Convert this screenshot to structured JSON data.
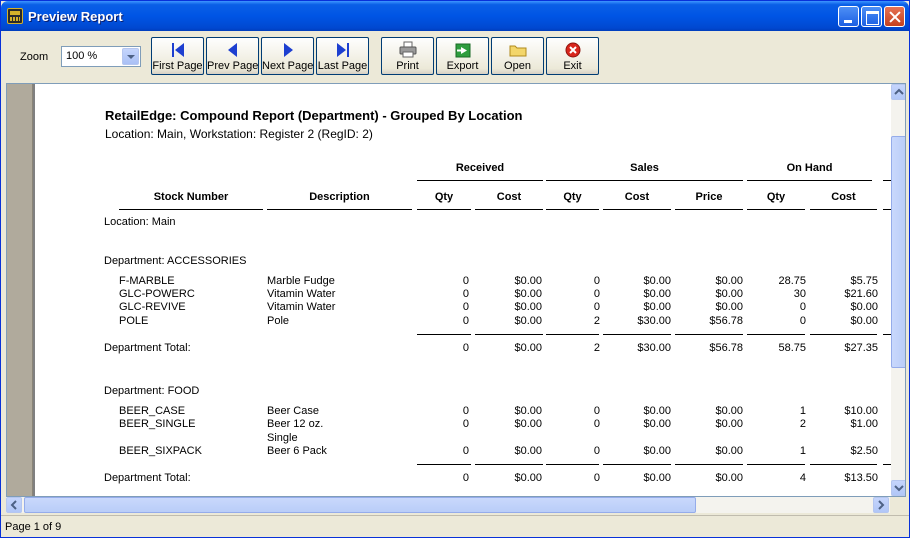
{
  "window": {
    "title": "Preview Report"
  },
  "toolbar": {
    "zoom_label": "Zoom",
    "zoom_value": "100 %",
    "buttons": [
      {
        "label": "First Page",
        "icon": "first-page-icon"
      },
      {
        "label": "Prev Page",
        "icon": "prev-page-icon"
      },
      {
        "label": "Next Page",
        "icon": "next-page-icon"
      },
      {
        "label": "Last Page",
        "icon": "last-page-icon"
      },
      {
        "label": "Print",
        "icon": "printer-icon"
      },
      {
        "label": "Export",
        "icon": "export-icon"
      },
      {
        "label": "Open",
        "icon": "folder-icon"
      },
      {
        "label": "Exit",
        "icon": "exit-icon"
      }
    ]
  },
  "report": {
    "title": "RetailEdge: Compound Report (Department) - Grouped By Location",
    "subtitle": "Location: Main, Workstation: Register 2 (RegID: 2)",
    "group_headers": {
      "received": "Received",
      "sales": "Sales",
      "on_hand": "On Hand"
    },
    "columns": [
      "Stock Number",
      "Description",
      "Qty",
      "Cost",
      "Qty",
      "Cost",
      "Price",
      "Qty",
      "Cost"
    ],
    "location_label": "Location: Main",
    "departments": [
      {
        "label": "Department: ACCESSORIES",
        "rows": [
          {
            "stock": "F-MARBLE",
            "desc": "Marble Fudge",
            "rq": "0",
            "rc": "$0.00",
            "sq": "0",
            "sc": "$0.00",
            "sp": "$0.00",
            "oq": "28.75",
            "oc": "$5.75"
          },
          {
            "stock": "GLC-POWERC",
            "desc": "Vitamin Water",
            "rq": "0",
            "rc": "$0.00",
            "sq": "0",
            "sc": "$0.00",
            "sp": "$0.00",
            "oq": "30",
            "oc": "$21.60"
          },
          {
            "stock": "GLC-REVIVE",
            "desc": "Vitamin Water",
            "rq": "0",
            "rc": "$0.00",
            "sq": "0",
            "sc": "$0.00",
            "sp": "$0.00",
            "oq": "0",
            "oc": "$0.00"
          },
          {
            "stock": "POLE",
            "desc": "Pole",
            "rq": "0",
            "rc": "$0.00",
            "sq": "2",
            "sc": "$30.00",
            "sp": "$56.78",
            "oq": "0",
            "oc": "$0.00"
          }
        ],
        "total": {
          "label": "Department Total:",
          "rq": "0",
          "rc": "$0.00",
          "sq": "2",
          "sc": "$30.00",
          "sp": "$56.78",
          "oq": "58.75",
          "oc": "$27.35"
        }
      },
      {
        "label": "Department: FOOD",
        "rows": [
          {
            "stock": "BEER_CASE",
            "desc": "Beer Case",
            "rq": "0",
            "rc": "$0.00",
            "sq": "0",
            "sc": "$0.00",
            "sp": "$0.00",
            "oq": "1",
            "oc": "$10.00"
          },
          {
            "stock": "BEER_SINGLE",
            "desc": "Beer 12 oz.",
            "desc2": "Single",
            "rq": "0",
            "rc": "$0.00",
            "sq": "0",
            "sc": "$0.00",
            "sp": "$0.00",
            "oq": "2",
            "oc": "$1.00"
          },
          {
            "stock": "BEER_SIXPACK",
            "desc": "Beer 6 Pack",
            "rq": "0",
            "rc": "$0.00",
            "sq": "0",
            "sc": "$0.00",
            "sp": "$0.00",
            "oq": "1",
            "oc": "$2.50"
          }
        ],
        "total": {
          "label": "Department Total:",
          "rq": "0",
          "rc": "$0.00",
          "sq": "0",
          "sc": "$0.00",
          "sp": "$0.00",
          "oq": "4",
          "oc": "$13.50"
        }
      }
    ]
  },
  "status": {
    "page_text": "Page 1 of 9"
  }
}
